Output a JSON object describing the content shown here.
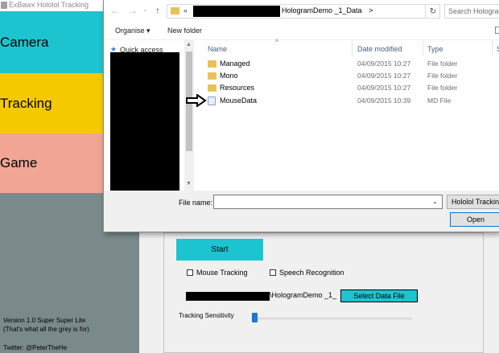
{
  "app": {
    "title": "ExBawx Hololol Tracking",
    "sidebar": {
      "camera": "Camera",
      "tracking": "Tracking",
      "game": "Game"
    },
    "version_line1": "Version 1.0 Super Super Lite",
    "version_line2": "(That's what all the grey is for)",
    "twitter": "Twitter: @PeterTheHe",
    "start_label": "Start",
    "mouse_tracking_label": "Mouse Tracking",
    "speech_recognition_label": "Speech Recognition",
    "data_path_suffix": "\\HologramDemo _1_",
    "select_data_file_label": "Select Data File",
    "tracking_sensitivity_label": "Tracking Sensitivity",
    "tracking_sensitivity_level": 0.02,
    "colors": {
      "camera": "#1cc4cf",
      "tracking": "#f4c900",
      "game": "#f0a595",
      "grey_panel": "#7a8a8b",
      "slider_thumb": "#1b78d2"
    }
  },
  "dialog": {
    "address": {
      "prefix": "«",
      "current_folder": "HologramDemo _1_Data",
      "separator": ">"
    },
    "search_placeholder": "Search Hologram",
    "toolbar": {
      "organise": "Organise ▾",
      "new_folder": "New folder"
    },
    "nav": {
      "quick_access": "Quick access"
    },
    "columns": {
      "name": "Name",
      "date_modified": "Date modified",
      "type": "Type",
      "size": "S"
    },
    "files": [
      {
        "name": "Managed",
        "date": "04/09/2015 10:27",
        "type": "File folder",
        "icon": "folder-icon"
      },
      {
        "name": "Mono",
        "date": "04/09/2015 10:27",
        "type": "File folder",
        "icon": "folder-icon"
      },
      {
        "name": "Resources",
        "date": "04/09/2015 10:27",
        "type": "File folder",
        "icon": "folder-icon"
      },
      {
        "name": "MouseData",
        "date": "04/09/2015 10:39",
        "type": "MD File",
        "icon": "file-icon"
      }
    ],
    "file_name_label": "File name:",
    "file_name_value": "",
    "filter_label": "Hololol Tracking",
    "open_label": "Open"
  }
}
